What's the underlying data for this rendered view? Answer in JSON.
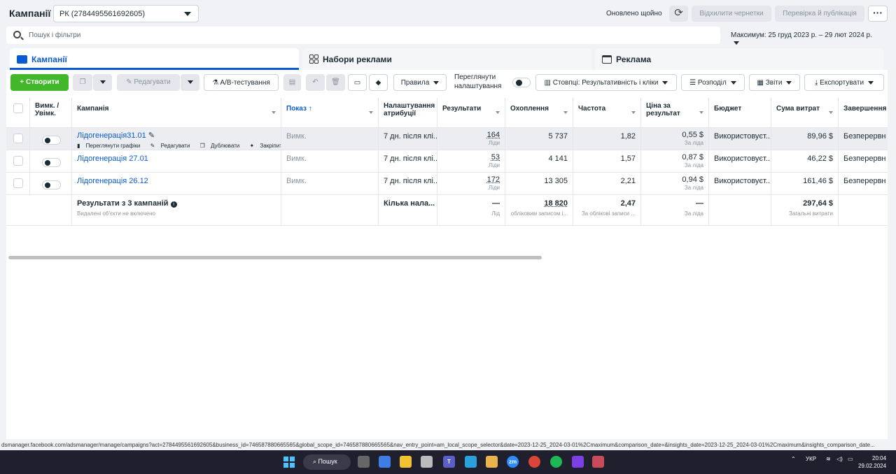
{
  "header": {
    "title": "Кампанії",
    "account": "РК (2784495561692605)",
    "updated_status": "Оновлено щойно",
    "discard_label": "Відхилити чернетки",
    "publish_label": "Перевірка й публікація",
    "more_label": "···"
  },
  "search": {
    "placeholder": "Пошук і фільтри"
  },
  "date_range": "Максимум: 25 груд 2023 р. – 29 лют 2024 р.",
  "tabs": [
    {
      "label": "Кампанії",
      "active": true
    },
    {
      "label": "Набори реклами"
    },
    {
      "label": "Реклама"
    }
  ],
  "toolbar": {
    "create": "+ Створити",
    "edit": "Редагувати",
    "ab_test": "A/B-тестування",
    "rules": "Правила",
    "review_line1": "Переглянути",
    "review_line2": "налаштування",
    "columns": "Стовпці: Результативність і кліки",
    "breakdown": "Розподіл",
    "reports": "Звіти",
    "export": "Експортувати"
  },
  "columns": {
    "onoff": "Вимк. / Увімк.",
    "campaign": "Кампанія",
    "delivery": "Показ ↑",
    "attribution": "Налаштування атрибуції",
    "results": "Результати",
    "reach": "Охоплення",
    "frequency": "Частота",
    "cost_per_result": "Ціна за результат",
    "budget": "Бюджет",
    "amount_spent": "Сума витрат",
    "ends": "Завершення"
  },
  "rows": [
    {
      "name": "Лідогенерація31.01",
      "actions": [
        "Переглянути графіки",
        "Редагувати",
        "Дублювати",
        "Закріпити"
      ],
      "delivery": "Вимк.",
      "attribution": "7 дн. після клі...",
      "results": "164",
      "results_unit": "Ліди",
      "reach": "5 737",
      "frequency": "1,82",
      "cost_per_result": "0,55 $",
      "cost_unit": "За ліда",
      "budget": "Використовуєт...",
      "amount_spent": "89,96 $",
      "ends": "Безперервн"
    },
    {
      "name": "Лідогенерація 27.01",
      "delivery": "Вимк.",
      "attribution": "7 дн. після клі...",
      "results": "53",
      "results_unit": "Ліди",
      "reach": "4 141",
      "frequency": "1,57",
      "cost_per_result": "0,87 $",
      "cost_unit": "За ліда",
      "budget": "Використовуєт...",
      "amount_spent": "46,22 $",
      "ends": "Безперервн"
    },
    {
      "name": "Лідогенерація 26.12",
      "delivery": "Вимк.",
      "attribution": "7 дн. після клі...",
      "results": "172",
      "results_unit": "Ліди",
      "reach": "13 305",
      "frequency": "2,21",
      "cost_per_result": "0,94 $",
      "cost_unit": "За ліда",
      "budget": "Використовуєт...",
      "amount_spent": "161,46 $",
      "ends": "Безперервн"
    }
  ],
  "summary": {
    "title": "Результати з 3 кампаній",
    "note": "Видалені об'єкти не включено",
    "attribution": "Кілька нала...",
    "results": "—",
    "results_unit": "Лід",
    "reach": "18 820",
    "reach_unit": "обліковим записом і...",
    "frequency": "2,47",
    "frequency_unit": "За облікові записи ...",
    "cost_per_result": "—",
    "cost_unit": "За ліда",
    "amount_spent": "297,64 $",
    "amount_unit": "Загальні витрати"
  },
  "status_url": "dsmanager.facebook.com/adsmanager/manage/campaigns?act=2784495561692605&business_id=746587880665565&global_scope_id=746587880665565&nav_entry_point=am_local_scope_selector&date=2023-12-25_2024-03-01%2Cmaximum&comparison_date=&insights_date=2023-12-25_2024-03-01%2Cmaximum&insights_comparison_date...",
  "taskbar": {
    "search": "Пошук",
    "lang": "УКР",
    "time": "20:04",
    "date": "29.02.2024"
  }
}
